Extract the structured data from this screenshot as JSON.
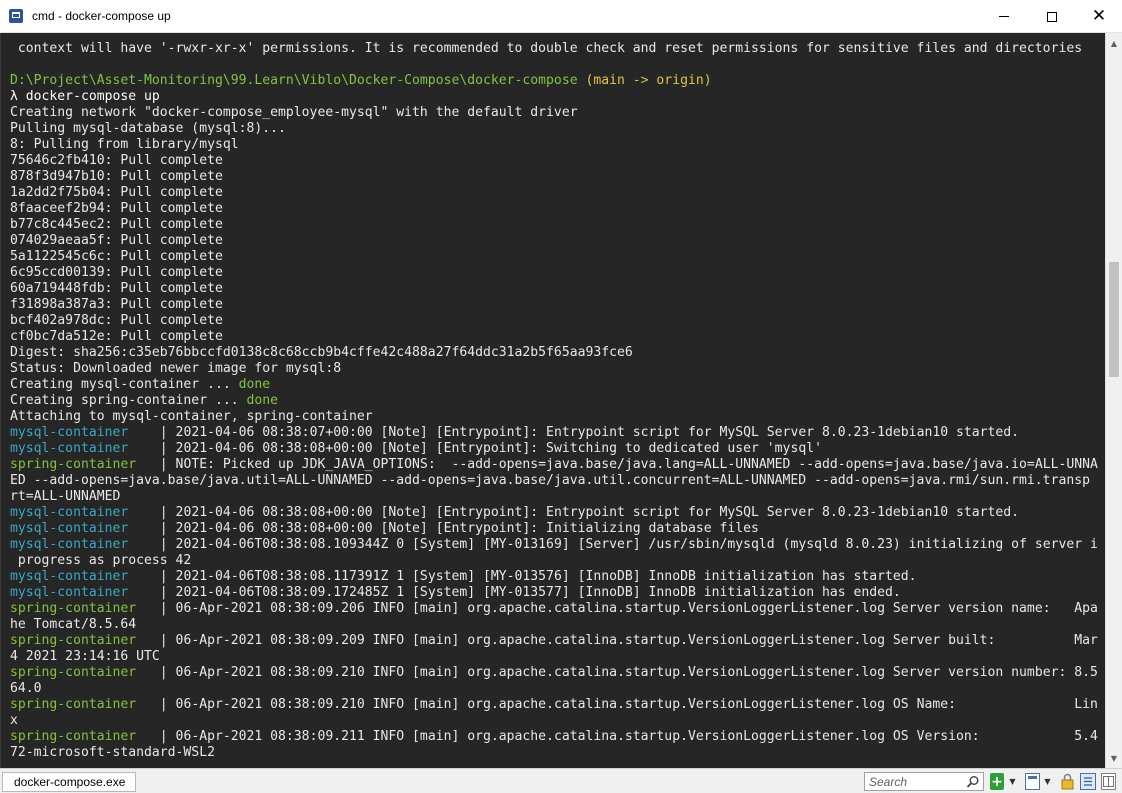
{
  "window": {
    "title": "cmd - docker-compose  up",
    "minimize_glyph": "",
    "close_glyph": "✕"
  },
  "console": {
    "lines": [
      {
        "segments": [
          {
            "text": " context will have '-rwxr-xr-x' permissions. It is recommended to double check and reset permissions for sensitive files and directories",
            "color": "default"
          }
        ]
      },
      {
        "segments": [
          {
            "text": "",
            "color": "default"
          }
        ]
      },
      {
        "segments": [
          {
            "text": "D:\\Project\\Asset-Monitoring\\99.Learn\\Viblo\\Docker-Compose\\docker-compose",
            "color": "green"
          },
          {
            "text": " (main -> origin)",
            "color": "yellow"
          }
        ]
      },
      {
        "segments": [
          {
            "text": "λ docker-compose up",
            "color": "cmd"
          }
        ]
      },
      {
        "segments": [
          {
            "text": "Creating network \"docker-compose_employee-mysql\" with the default driver",
            "color": "default"
          }
        ]
      },
      {
        "segments": [
          {
            "text": "Pulling mysql-database (mysql:8)...",
            "color": "default"
          }
        ]
      },
      {
        "segments": [
          {
            "text": "8: Pulling from library/mysql",
            "color": "default"
          }
        ]
      },
      {
        "segments": [
          {
            "text": "75646c2fb410: Pull complete",
            "color": "default"
          }
        ]
      },
      {
        "segments": [
          {
            "text": "878f3d947b10: Pull complete",
            "color": "default"
          }
        ]
      },
      {
        "segments": [
          {
            "text": "1a2dd2f75b04: Pull complete",
            "color": "default"
          }
        ]
      },
      {
        "segments": [
          {
            "text": "8faaceef2b94: Pull complete",
            "color": "default"
          }
        ]
      },
      {
        "segments": [
          {
            "text": "b77c8c445ec2: Pull complete",
            "color": "default"
          }
        ]
      },
      {
        "segments": [
          {
            "text": "074029aeaa5f: Pull complete",
            "color": "default"
          }
        ]
      },
      {
        "segments": [
          {
            "text": "5a1122545c6c: Pull complete",
            "color": "default"
          }
        ]
      },
      {
        "segments": [
          {
            "text": "6c95ccd00139: Pull complete",
            "color": "default"
          }
        ]
      },
      {
        "segments": [
          {
            "text": "60a719448fdb: Pull complete",
            "color": "default"
          }
        ]
      },
      {
        "segments": [
          {
            "text": "f31898a387a3: Pull complete",
            "color": "default"
          }
        ]
      },
      {
        "segments": [
          {
            "text": "bcf402a978dc: Pull complete",
            "color": "default"
          }
        ]
      },
      {
        "segments": [
          {
            "text": "cf0bc7da512e: Pull complete",
            "color": "default"
          }
        ]
      },
      {
        "segments": [
          {
            "text": "Digest: sha256:c35eb76bbccfd0138c8c68ccb9b4cffe42c488a27f64ddc31a2b5f65aa93fce6",
            "color": "default"
          }
        ]
      },
      {
        "segments": [
          {
            "text": "Status: Downloaded newer image for mysql:8",
            "color": "default"
          }
        ]
      },
      {
        "segments": [
          {
            "text": "Creating mysql-container ... ",
            "color": "default"
          },
          {
            "text": "done",
            "color": "green"
          }
        ]
      },
      {
        "segments": [
          {
            "text": "Creating spring-container ... ",
            "color": "default"
          },
          {
            "text": "done",
            "color": "green"
          }
        ]
      },
      {
        "segments": [
          {
            "text": "Attaching to mysql-container, spring-container",
            "color": "default"
          }
        ]
      },
      {
        "segments": [
          {
            "text": "mysql-container   ",
            "color": "teal"
          },
          {
            "text": " | 2021-04-06 08:38:07+00:00 [Note] [Entrypoint]: Entrypoint script for MySQL Server 8.0.23-1debian10 started.",
            "color": "default"
          }
        ]
      },
      {
        "segments": [
          {
            "text": "mysql-container   ",
            "color": "teal"
          },
          {
            "text": " | 2021-04-06 08:38:08+00:00 [Note] [Entrypoint]: Switching to dedicated user 'mysql'",
            "color": "default"
          }
        ]
      },
      {
        "segments": [
          {
            "text": "spring-container  ",
            "color": "green"
          },
          {
            "text": " | NOTE: Picked up JDK_JAVA_OPTIONS:  --add-opens=java.base/java.lang=ALL-UNNAMED --add-opens=java.base/java.io=ALL-UNNA",
            "color": "default"
          }
        ]
      },
      {
        "segments": [
          {
            "text": "ED --add-opens=java.base/java.util=ALL-UNNAMED --add-opens=java.base/java.util.concurrent=ALL-UNNAMED --add-opens=java.rmi/sun.rmi.transp",
            "color": "default"
          }
        ]
      },
      {
        "segments": [
          {
            "text": "rt=ALL-UNNAMED",
            "color": "default"
          }
        ]
      },
      {
        "segments": [
          {
            "text": "mysql-container   ",
            "color": "teal"
          },
          {
            "text": " | 2021-04-06 08:38:08+00:00 [Note] [Entrypoint]: Entrypoint script for MySQL Server 8.0.23-1debian10 started.",
            "color": "default"
          }
        ]
      },
      {
        "segments": [
          {
            "text": "mysql-container   ",
            "color": "teal"
          },
          {
            "text": " | 2021-04-06 08:38:08+00:00 [Note] [Entrypoint]: Initializing database files",
            "color": "default"
          }
        ]
      },
      {
        "segments": [
          {
            "text": "mysql-container   ",
            "color": "teal"
          },
          {
            "text": " | 2021-04-06T08:38:08.109344Z 0 [System] [MY-013169] [Server] /usr/sbin/mysqld (mysqld 8.0.23) initializing of server i",
            "color": "default"
          }
        ]
      },
      {
        "segments": [
          {
            "text": " progress as process 42",
            "color": "default"
          }
        ]
      },
      {
        "segments": [
          {
            "text": "mysql-container   ",
            "color": "teal"
          },
          {
            "text": " | 2021-04-06T08:38:08.117391Z 1 [System] [MY-013576] [InnoDB] InnoDB initialization has started.",
            "color": "default"
          }
        ]
      },
      {
        "segments": [
          {
            "text": "mysql-container   ",
            "color": "teal"
          },
          {
            "text": " | 2021-04-06T08:38:09.172485Z 1 [System] [MY-013577] [InnoDB] InnoDB initialization has ended.",
            "color": "default"
          }
        ]
      },
      {
        "segments": [
          {
            "text": "spring-container  ",
            "color": "green"
          },
          {
            "text": " | 06-Apr-2021 08:38:09.206 INFO [main] org.apache.catalina.startup.VersionLoggerListener.log Server version name:   Apa",
            "color": "default"
          }
        ]
      },
      {
        "segments": [
          {
            "text": "he Tomcat/8.5.64",
            "color": "default"
          }
        ]
      },
      {
        "segments": [
          {
            "text": "spring-container  ",
            "color": "green"
          },
          {
            "text": " | 06-Apr-2021 08:38:09.209 INFO [main] org.apache.catalina.startup.VersionLoggerListener.log Server built:          Mar",
            "color": "default"
          }
        ]
      },
      {
        "segments": [
          {
            "text": "4 2021 23:14:16 UTC",
            "color": "default"
          }
        ]
      },
      {
        "segments": [
          {
            "text": "spring-container  ",
            "color": "green"
          },
          {
            "text": " | 06-Apr-2021 08:38:09.210 INFO [main] org.apache.catalina.startup.VersionLoggerListener.log Server version number: 8.5",
            "color": "default"
          }
        ]
      },
      {
        "segments": [
          {
            "text": "64.0",
            "color": "default"
          }
        ]
      },
      {
        "segments": [
          {
            "text": "spring-container  ",
            "color": "green"
          },
          {
            "text": " | 06-Apr-2021 08:38:09.210 INFO [main] org.apache.catalina.startup.VersionLoggerListener.log OS Name:               Lin",
            "color": "default"
          }
        ]
      },
      {
        "segments": [
          {
            "text": "x",
            "color": "default"
          }
        ]
      },
      {
        "segments": [
          {
            "text": "spring-container  ",
            "color": "green"
          },
          {
            "text": " | 06-Apr-2021 08:38:09.211 INFO [main] org.apache.catalina.startup.VersionLoggerListener.log OS Version:            5.4",
            "color": "default"
          }
        ]
      },
      {
        "segments": [
          {
            "text": "72-microsoft-standard-WSL2",
            "color": "default"
          }
        ]
      }
    ]
  },
  "statusbar": {
    "tab_label": "docker-compose.exe",
    "search_placeholder": "Search"
  },
  "colors": {
    "console_bg": "#262626",
    "default": "#e8e8e8",
    "teal": "#3aa8c4",
    "green": "#82c341",
    "yellow": "#e0c341"
  },
  "icons": [
    "app-icon",
    "minimize-icon",
    "maximize-icon",
    "close-icon",
    "search-icon",
    "new-tab-icon",
    "dropdown-icon",
    "view-icon",
    "lock-icon",
    "menu-icon",
    "layout-icon"
  ]
}
